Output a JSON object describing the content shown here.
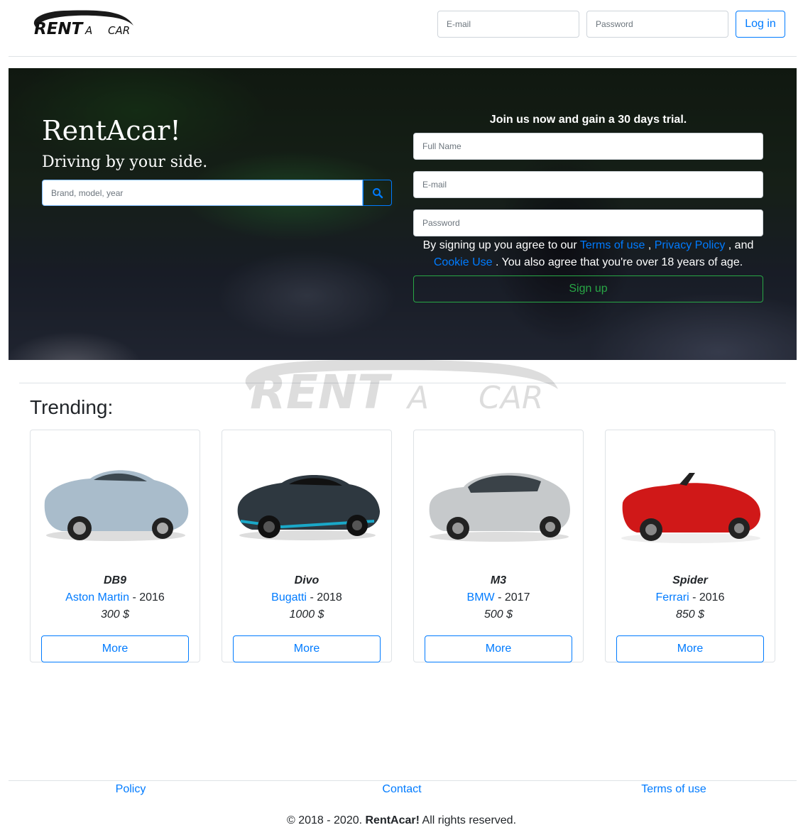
{
  "logo": {
    "text_main": "RENT",
    "text_a": "A",
    "text_car": "CAR"
  },
  "header": {
    "email_placeholder": "E-mail",
    "password_placeholder": "Password",
    "login_label": "Log in"
  },
  "hero": {
    "title": "RentAcar!",
    "subtitle": "Driving by your side.",
    "search_placeholder": "Brand, model, year",
    "join_text": "Join us now and gain a 30 days trial.",
    "fullname_placeholder": "Full Name",
    "email_placeholder": "E-mail",
    "password_placeholder": "Password",
    "terms_prefix": "By signing up you agree to our ",
    "terms_link": "Terms of use",
    "sep1": " , ",
    "privacy_link": "Privacy Policy",
    "sep2": " , and ",
    "cookie_link": "Cookie Use",
    "terms_suffix": " . You also agree that you're over 18 years of age.",
    "signup_label": "Sign up"
  },
  "trending": {
    "title": "Trending:",
    "cars": [
      {
        "model": "DB9",
        "brand": "Aston Martin",
        "year": "- 2016",
        "price": "300 $",
        "more": "More",
        "color": "#a9bccb"
      },
      {
        "model": "Divo",
        "brand": "Bugatti",
        "year": "- 2018",
        "price": "1000 $",
        "more": "More",
        "color": "#2e3840"
      },
      {
        "model": "M3",
        "brand": "BMW",
        "year": "- 2017",
        "price": "500 $",
        "more": "More",
        "color": "#c6c9cb"
      },
      {
        "model": "Spider",
        "brand": "Ferrari",
        "year": "- 2016",
        "price": "850 $",
        "more": "More",
        "color": "#d01818"
      }
    ]
  },
  "footer": {
    "policy": "Policy",
    "contact": "Contact",
    "terms": "Terms of use",
    "copyright_prefix": "© 2018 - 2020. ",
    "copyright_brand": "RentAcar!",
    "copyright_suffix": " All rights reserved."
  },
  "colors": {
    "primary": "#007bff",
    "success": "#28a745",
    "border": "#dee2e6"
  }
}
